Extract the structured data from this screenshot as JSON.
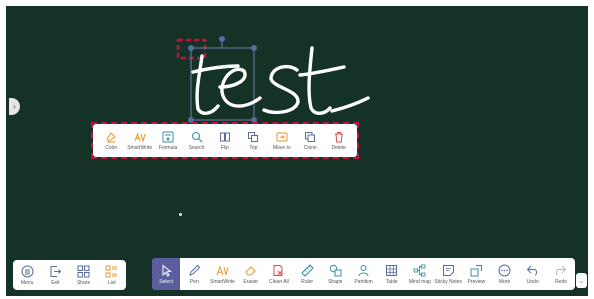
{
  "board": {
    "background": "#153227",
    "handwriting": "test"
  },
  "context_toolbar": {
    "items": [
      {
        "label": "Color",
        "icon": "color-icon"
      },
      {
        "label": "SmartWrite",
        "icon": "smartwrite-icon"
      },
      {
        "label": "Formula",
        "icon": "formula-icon"
      },
      {
        "label": "Search",
        "icon": "search-icon"
      },
      {
        "label": "Flip",
        "icon": "flip-icon"
      },
      {
        "label": "Top",
        "icon": "top-icon"
      },
      {
        "label": "Move to",
        "icon": "move-to-icon"
      },
      {
        "label": "Clone",
        "icon": "clone-icon"
      },
      {
        "label": "Delete",
        "icon": "delete-icon"
      }
    ]
  },
  "left_toolbar": {
    "items": [
      {
        "label": "Menu",
        "icon": "menu-icon"
      },
      {
        "label": "Exit",
        "icon": "exit-icon"
      },
      {
        "label": "Share",
        "icon": "share-icon"
      },
      {
        "label": "List",
        "icon": "list-icon"
      }
    ]
  },
  "main_toolbar": {
    "active": "Select",
    "items": [
      {
        "label": "Select",
        "icon": "select-icon"
      },
      {
        "label": "Pen",
        "icon": "pen-icon"
      },
      {
        "label": "SmartWrite",
        "icon": "smartwrite-icon"
      },
      {
        "label": "Eraser",
        "icon": "eraser-icon"
      },
      {
        "label": "Clean All",
        "icon": "clean-all-icon"
      },
      {
        "label": "Ruler",
        "icon": "ruler-icon"
      },
      {
        "label": "Shape",
        "icon": "shape-icon"
      },
      {
        "label": "Partition",
        "icon": "partition-icon"
      },
      {
        "label": "Table",
        "icon": "table-icon"
      },
      {
        "label": "Mind map",
        "icon": "mind-map-icon"
      },
      {
        "label": "Sticky Notes",
        "icon": "sticky-notes-icon"
      },
      {
        "label": "Preview",
        "icon": "preview-icon"
      },
      {
        "label": "More",
        "icon": "more-icon"
      },
      {
        "label": "Undo",
        "icon": "undo-icon"
      },
      {
        "label": "Redo",
        "icon": "redo-icon"
      }
    ]
  },
  "colors": {
    "accent": "#5b5d9e",
    "orange": "#e8962c",
    "icon": "#5a6b9e",
    "delete": "#e04a4a",
    "highlight": "#c0143c"
  }
}
